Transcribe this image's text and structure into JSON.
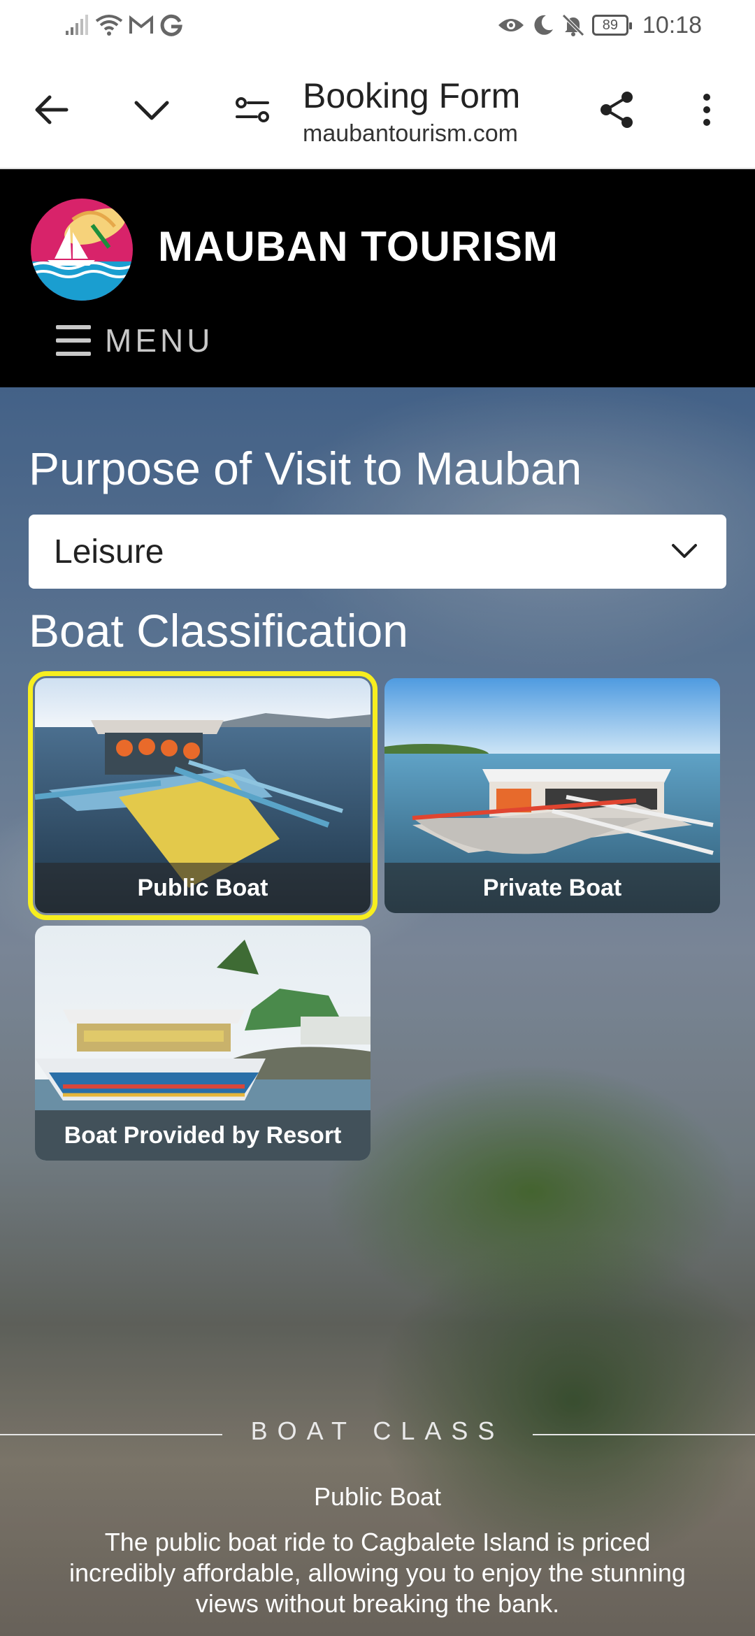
{
  "status_bar": {
    "time": "10:18",
    "battery": "89"
  },
  "browser": {
    "page_title": "Booking Form",
    "url": "maubantourism.com"
  },
  "site": {
    "name": "MAUBAN TOURISM",
    "menu_label": "MENU"
  },
  "form": {
    "purpose_label": "Purpose of Visit to Mauban",
    "purpose_value": "Leisure",
    "boat_label": "Boat Classification",
    "boat_options": [
      {
        "label": "Public Boat",
        "selected": true
      },
      {
        "label": "Private Boat",
        "selected": false
      },
      {
        "label": "Boat Provided by Resort",
        "selected": false
      }
    ]
  },
  "boat_class": {
    "heading": "BOAT CLASS",
    "title": "Public Boat",
    "description": "The public boat ride to Cagbalete Island is priced incredibly affordable, allowing you to enjoy the stunning views without breaking the bank."
  },
  "colors": {
    "selected_outline": "#f7ee1f",
    "header_bg": "#000000"
  }
}
